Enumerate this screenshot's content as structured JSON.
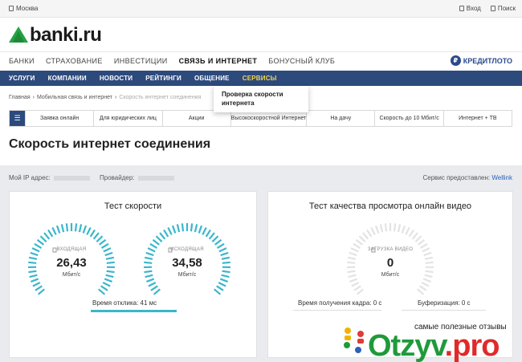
{
  "topbar": {
    "city": "Москва",
    "login": "Вход",
    "search": "Поиск"
  },
  "logo": {
    "text": "banki.ru"
  },
  "main_nav": {
    "items": [
      "БАНКИ",
      "СТРАХОВАНИЕ",
      "ИНВЕСТИЦИИ",
      "СВЯЗЬ И ИНТЕРНЕТ",
      "БОНУСНЫЙ КЛУБ"
    ],
    "active": "СВЯЗЬ И ИНТЕРНЕТ",
    "kredit": "КРЕДИТЛОТО"
  },
  "sub_nav": {
    "items": [
      "УСЛУГИ",
      "КОМПАНИИ",
      "НОВОСТИ",
      "РЕЙТИНГИ",
      "ОБЩЕНИЕ",
      "СЕРВИСЫ"
    ],
    "highlighted": "СЕРВИСЫ"
  },
  "dropdown": {
    "item": "Проверка скорости интернета"
  },
  "breadcrumb": {
    "items": [
      "Главная",
      "Мобильная связь и интернет",
      "Скорость интернет соединения"
    ]
  },
  "tabs": [
    "Заявка онлайн",
    "Для юридических лиц",
    "Акции",
    "Высокоскоростной Интернет",
    "На дачу",
    "Скорость до 10 Мбит/с",
    "Интернет + ТВ"
  ],
  "page_title": "Скорость интернет соединения",
  "info": {
    "ip_label": "Мой IP адрес:",
    "provider_label": "Провайдер:",
    "service_label": "Сервис предоставлен:",
    "service_name": "Wellink"
  },
  "speed_test": {
    "title": "Тест скорости",
    "incoming": {
      "label": "ВХОДЯЩАЯ",
      "value": "26,43",
      "unit": "Мбит/с"
    },
    "outgoing": {
      "label": "ИСХОДЯЩАЯ",
      "value": "34,58",
      "unit": "Мбит/с"
    },
    "ping_label": "Время отклика: 41 мс"
  },
  "video_test": {
    "title": "Тест качества просмотра онлайн видео",
    "download": {
      "label": "ЗАГРУЗКА ВИДЕО",
      "value": "0",
      "unit": "Мбит/с"
    },
    "frame_time": "Время получения кадра: 0 с",
    "buffering": "Буферизация: 0 с"
  },
  "watermark": {
    "tagline": "самые полезные отзывы",
    "brand": "Otzyv",
    "brand_suffix": ".pro"
  },
  "colors": {
    "nav_blue": "#2d4a7c",
    "gauge_cyan": "#3bb6cc",
    "gauge_grey": "#e3e3e3",
    "accent_yellow": "#f2d34a",
    "link_blue": "#2b62b8"
  }
}
